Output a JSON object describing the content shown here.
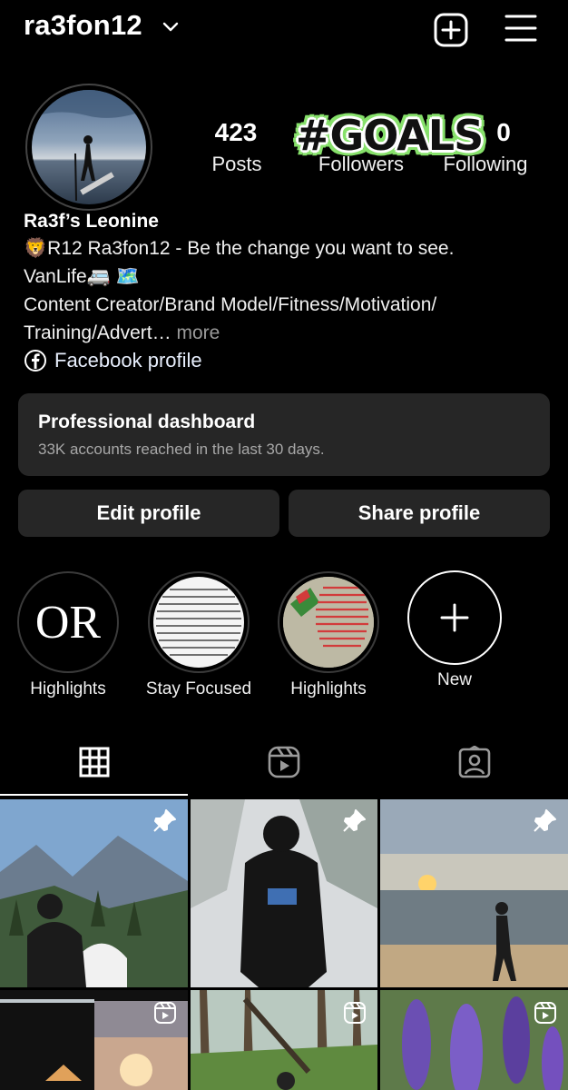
{
  "header": {
    "username": "ra3fon12",
    "new_post_icon": "plus-square-icon",
    "menu_icon": "hamburger-menu-icon"
  },
  "stats": {
    "posts": {
      "value": "423",
      "label": "Posts"
    },
    "followers": {
      "value": "",
      "label": "Followers"
    },
    "following": {
      "value": "0",
      "label": "Following"
    }
  },
  "sticker": "#GOALS",
  "profile": {
    "display_name": "Ra3f’s Leonine",
    "bio_line1": "🦁R12 Ra3fon12 - Be the change you want to see.",
    "bio_line2": "VanLife🚐 🗺️",
    "bio_line3": "Content Creator/Brand Model/Fitness/Motivation/",
    "bio_line4": "Training/Advert…",
    "more_label": " more",
    "facebook_link": "Facebook profile"
  },
  "dashboard": {
    "title": "Professional dashboard",
    "subtitle": "33K accounts reached in the last 30 days."
  },
  "buttons": {
    "edit_profile": "Edit profile",
    "share_profile": "Share profile"
  },
  "highlights": [
    {
      "label": "Highlights",
      "cover_text": "OR"
    },
    {
      "label": "Stay Focused"
    },
    {
      "label": "Highlights"
    },
    {
      "label": "New"
    }
  ],
  "tabs": [
    "grid-icon",
    "reels-icon",
    "tagged-icon"
  ],
  "colors": {
    "background": "#000000",
    "surface": "#262626",
    "sticker_green": "#86e06a"
  }
}
